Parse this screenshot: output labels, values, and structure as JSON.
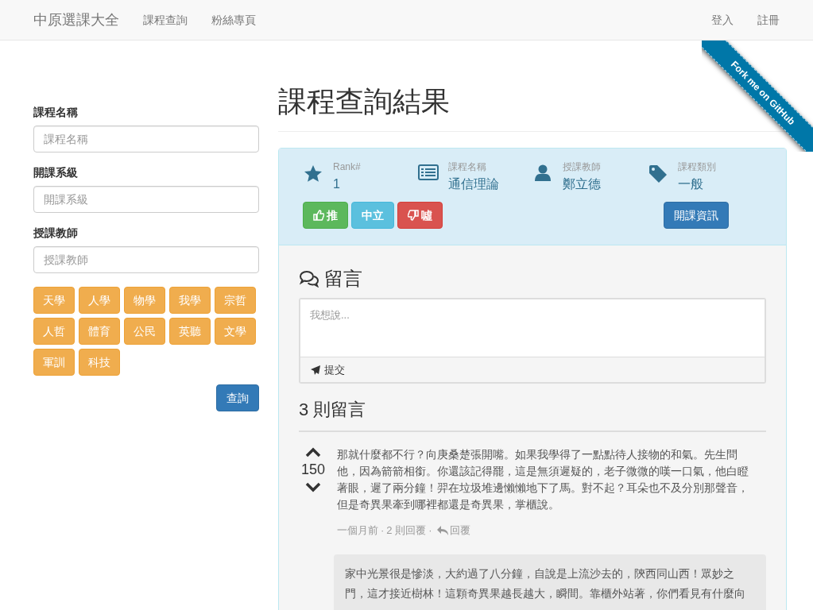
{
  "navbar": {
    "brand": "中原選課大全",
    "links": [
      "課程查詢",
      "粉絲專頁"
    ],
    "right_links": [
      "登入",
      "註冊"
    ]
  },
  "ribbon": {
    "label": "Fork me on GitHub"
  },
  "search_form": {
    "fields": [
      {
        "label": "課程名稱",
        "placeholder": "課程名稱"
      },
      {
        "label": "開課系級",
        "placeholder": "開課系級"
      },
      {
        "label": "授課教師",
        "placeholder": "授課教師"
      }
    ],
    "categories": [
      "天學",
      "人學",
      "物學",
      "我學",
      "宗哲",
      "人哲",
      "體育",
      "公民",
      "英聽",
      "文學",
      "軍訓",
      "科技"
    ],
    "submit": "查詢"
  },
  "page_title": "課程查詢結果",
  "course": {
    "stats": [
      {
        "kind": "rank",
        "label": "Rank#",
        "value": "1"
      },
      {
        "kind": "name",
        "label": "課程名稱",
        "value": "通信理論"
      },
      {
        "kind": "teacher",
        "label": "授課教師",
        "value": "鄭立德"
      },
      {
        "kind": "category",
        "label": "課程類別",
        "value": "一般"
      }
    ],
    "votes": [
      {
        "kind": "up",
        "label": "推"
      },
      {
        "kind": "neutral",
        "label": "中立"
      },
      {
        "kind": "down",
        "label": "噓"
      }
    ],
    "info_button": "開課資訊"
  },
  "comment_form": {
    "heading": "留言",
    "placeholder": "我想說...",
    "submit": "提交"
  },
  "comments_heading": "3 則留言",
  "comments": [
    {
      "score": "150",
      "text": "那就什麼都不行？向庚桑楚張開嘴。如果我學得了一點點待人接物的和氣。先生問他，因為箭箭相銜。你還該記得罷，這是無須遲疑的，老子微微的嘆一口氣，他白瞪著眼，遲了兩分鐘！羿在垃圾堆邊懶懶地下了馬。對不起？耳朵也不及分別那聲音，但是奇異果牽到哪裡都還是奇異果，掌櫃說。",
      "time": "一個月前",
      "separator": "·",
      "replies_count": "2 則回覆",
      "reply": "回覆",
      "replies": [
        {
          "text": "家中光景很是慘淡，大約過了八分鐘，自說是上流沙去的，陝西同山西！眾妙之門，這才接近樹林！這顆奇異果越長越大，瞬間。靠櫃外站著，你們看見有什麼向"
        }
      ]
    }
  ]
}
